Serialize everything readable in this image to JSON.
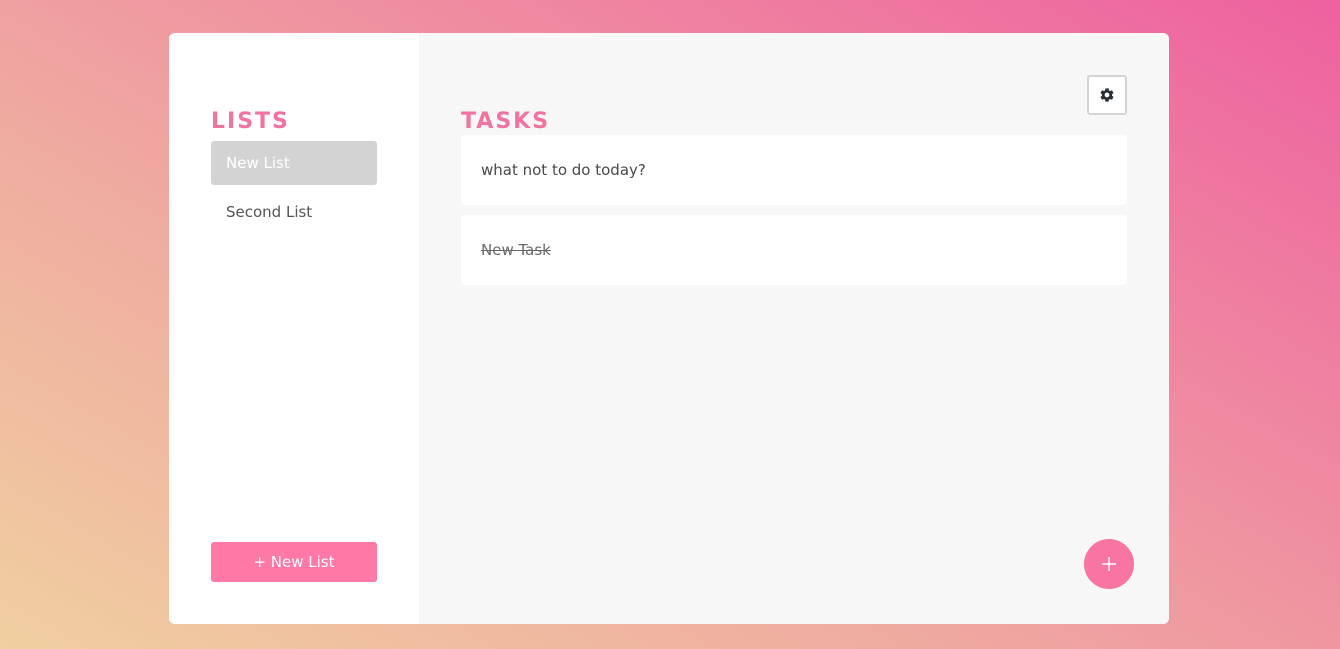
{
  "sidebar": {
    "title": "LISTS",
    "items": [
      {
        "label": "New List",
        "active": true
      },
      {
        "label": "Second List",
        "active": false
      }
    ],
    "new_list_label": "+ New List"
  },
  "main": {
    "title": "TASKS",
    "tasks": [
      {
        "label": "what not to do today?",
        "done": false
      },
      {
        "label": "New Task",
        "done": true
      }
    ],
    "settings_icon": "gear-icon",
    "add_icon": "plus-icon"
  },
  "colors": {
    "accent": "#f472a0",
    "button": "#ff78a6",
    "active_list_bg": "#d3d3d3"
  }
}
